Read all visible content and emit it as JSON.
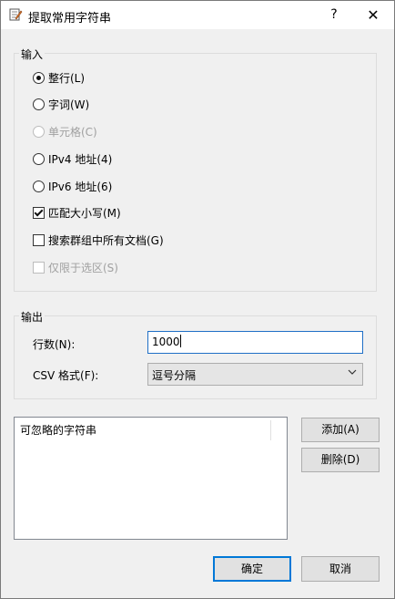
{
  "window": {
    "title": "提取常用字符串",
    "help_label": "?",
    "close_label": "✕"
  },
  "input_group": {
    "label": "输入",
    "options": {
      "line": "整行(L)",
      "word": "字词(W)",
      "cell": "单元格(C)",
      "ipv4": "IPv4 地址(4)",
      "ipv6": "IPv6 地址(6)",
      "match_case": "匹配大小写(M)",
      "search_group": "搜索群组中所有文档(G)",
      "selection_only": "仅限于选区(S)"
    }
  },
  "output_group": {
    "label": "输出",
    "lines_label": "行数(N):",
    "lines_value": "1000",
    "csv_label": "CSV 格式(F):",
    "csv_value": "逗号分隔"
  },
  "ignore_list": {
    "header": "可忽略的字符串"
  },
  "buttons": {
    "add": "添加(A)",
    "delete": "删除(D)",
    "ok": "确定",
    "cancel": "取消"
  }
}
